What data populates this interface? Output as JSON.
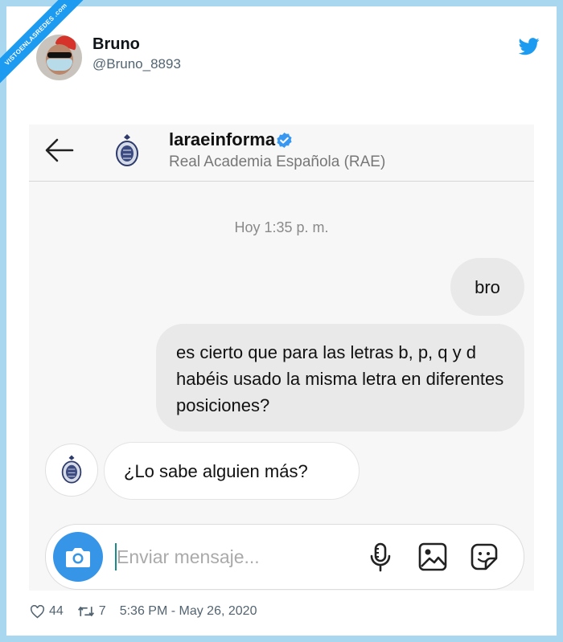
{
  "watermark": "VISTOENLASREDES .com",
  "tweet": {
    "author_name": "Bruno",
    "author_handle": "@Bruno_8893",
    "likes": "44",
    "retweets": "7",
    "timestamp": "5:36 PM - May 26, 2020"
  },
  "dm": {
    "account_name": "laraeinforma",
    "account_subtitle": "Real Academia Española (RAE)",
    "time_divider": "Hoy 1:35 p. m.",
    "messages": [
      {
        "from": "me",
        "text": "bro"
      },
      {
        "from": "me",
        "text": "es cierto que para las letras b, p, q y d habéis usado la misma letra en diferentes posiciones?"
      },
      {
        "from": "them",
        "text": "¿Lo sabe alguien más?"
      }
    ],
    "composer_placeholder": "Enviar mensaje..."
  },
  "colors": {
    "twitter_blue": "#1d9bf0",
    "verified_blue": "#3897f0",
    "frame_border": "#a9d7f0"
  }
}
